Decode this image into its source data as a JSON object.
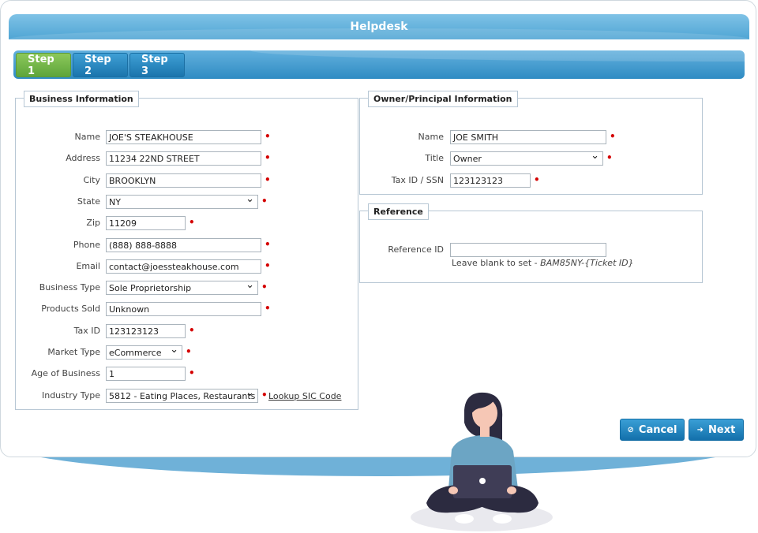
{
  "header": {
    "title": "Helpdesk"
  },
  "tabs": [
    {
      "label": "Step 1",
      "active": true
    },
    {
      "label": "Step 2",
      "active": false
    },
    {
      "label": "Step 3",
      "active": false
    }
  ],
  "business": {
    "legend": "Business Information",
    "name_label": "Name",
    "name_value": "JOE'S STEAKHOUSE",
    "address_label": "Address",
    "address_value": "11234 22ND STREET",
    "city_label": "City",
    "city_value": "BROOKLYN",
    "state_label": "State",
    "state_value": "NY",
    "zip_label": "Zip",
    "zip_value": "11209",
    "phone_label": "Phone",
    "phone_value": "(888) 888-8888",
    "email_label": "Email",
    "email_value": "contact@joessteakhouse.com",
    "business_type_label": "Business Type",
    "business_type_value": "Sole Proprietorship",
    "products_label": "Products Sold",
    "products_value": "Unknown",
    "taxid_label": "Tax ID",
    "taxid_value": "123123123",
    "market_label": "Market Type",
    "market_value": "eCommerce",
    "age_label": "Age of Business",
    "age_value": "1",
    "industry_label": "Industry Type",
    "industry_value": "5812 - Eating Places, Restaurants",
    "lookup_link": "Lookup SIC Code"
  },
  "owner": {
    "legend": "Owner/Principal Information",
    "name_label": "Name",
    "name_value": "JOE SMITH",
    "title_label": "Title",
    "title_value": "Owner",
    "taxid_label": "Tax ID / SSN",
    "taxid_value": "123123123"
  },
  "reference": {
    "legend": "Reference",
    "id_label": "Reference ID",
    "id_value": "",
    "hint_prefix": "Leave blank to set - ",
    "hint_code": "BAM85NY-{Ticket ID}"
  },
  "actions": {
    "cancel": "Cancel",
    "next": "Next"
  },
  "colors": {
    "accent": "#1a75ad",
    "active_tab": "#5ea53a",
    "required": "#d40000"
  }
}
